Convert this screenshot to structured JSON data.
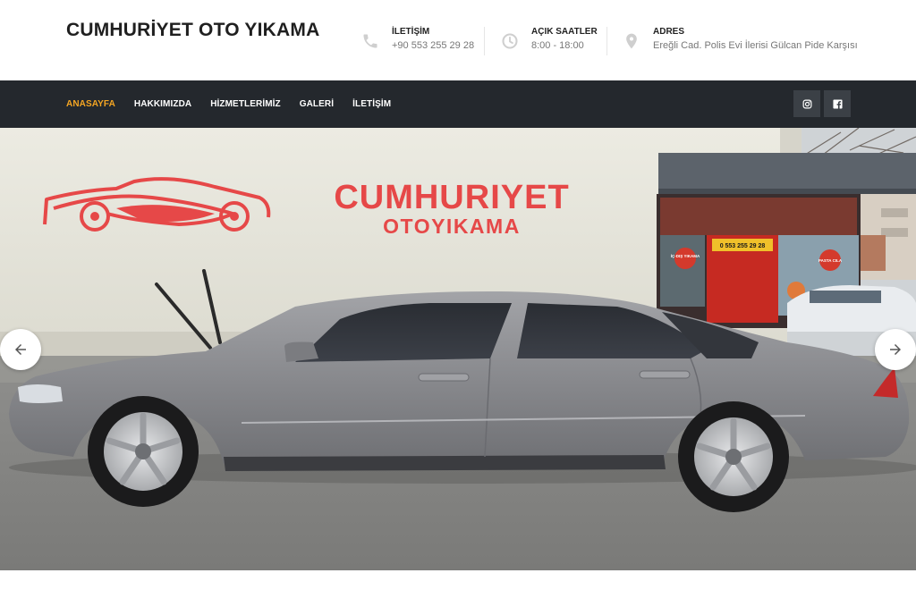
{
  "header": {
    "brand": "CUMHURİYET OTO YIKAMA",
    "contacts": [
      {
        "icon": "phone-icon",
        "label": "İLETİŞİM",
        "value": "+90 553 255 29 28"
      },
      {
        "icon": "clock-icon",
        "label": "AÇIK SAATLER",
        "value": "8:00 - 18:00"
      },
      {
        "icon": "location-pin-icon",
        "label": "ADRES",
        "value": "Ereğli Cad. Polis Evi İlerisi Gülcan Pide Karşısı"
      }
    ]
  },
  "nav": {
    "items": [
      {
        "label": "ANASAYFA",
        "active": true
      },
      {
        "label": "HAKKIMIZDA",
        "active": false
      },
      {
        "label": "HİZMETLERİMİZ",
        "active": false
      },
      {
        "label": "GALERİ",
        "active": false
      },
      {
        "label": "İLETİŞİM",
        "active": false
      }
    ],
    "social": [
      "instagram-icon",
      "facebook-icon"
    ]
  },
  "hero": {
    "sign_line1": "CUMHURIYET",
    "sign_line2": "OTOYIKAMA",
    "shop_phone": "0 553 255 29 28",
    "shop_badge1": "İÇ-DIŞ YIKAMA",
    "shop_badge2": "PASTA CILA"
  },
  "colors": {
    "nav_bg": "#24282d",
    "accent": "#f5a623",
    "sign_red": "#e64848"
  }
}
